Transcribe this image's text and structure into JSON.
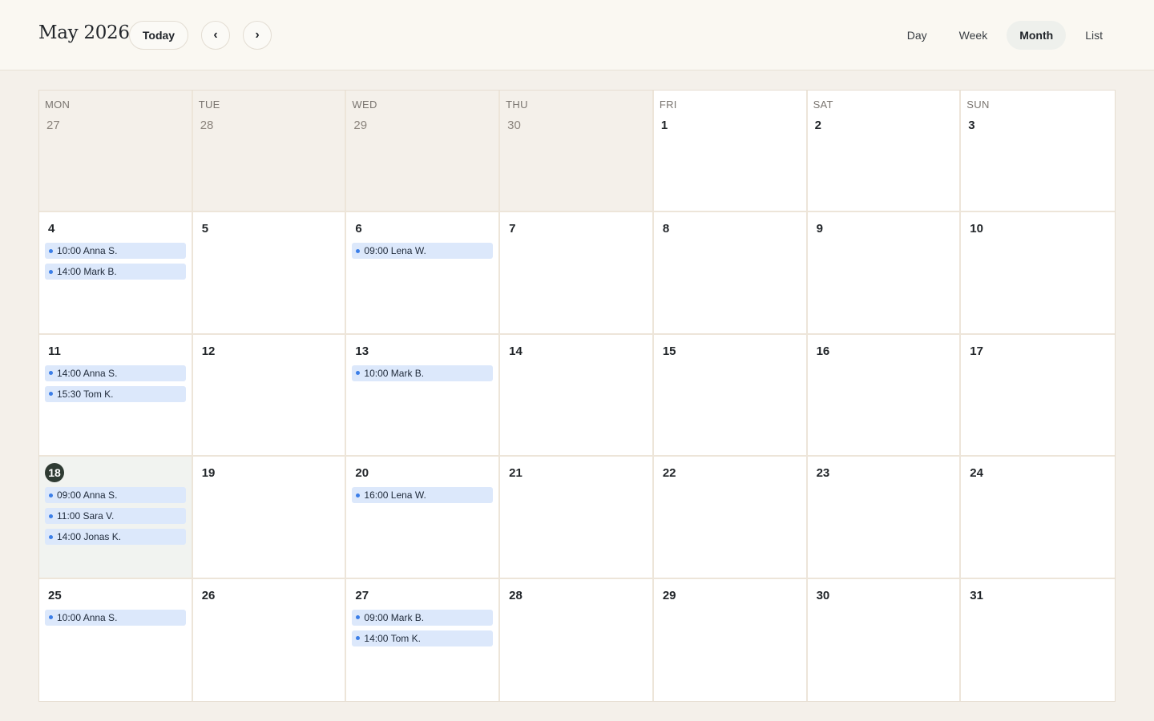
{
  "header": {
    "title": "May 2026",
    "today_label": "Today",
    "prev_label": "‹",
    "next_label": "›",
    "views": [
      {
        "label": "Day",
        "active": false
      },
      {
        "label": "Week",
        "active": false
      },
      {
        "label": "Month",
        "active": true
      },
      {
        "label": "List",
        "active": false
      }
    ]
  },
  "colors": {
    "event_bg": "#dce8fb",
    "event_dot": "#3b7ee8",
    "today_badge": "#2f3b33"
  },
  "weekdays": [
    "MON",
    "TUE",
    "WED",
    "THU",
    "FRI",
    "SAT",
    "SUN"
  ],
  "weeks": [
    [
      {
        "day": "27",
        "outside": true,
        "events": []
      },
      {
        "day": "28",
        "outside": true,
        "events": []
      },
      {
        "day": "29",
        "outside": true,
        "events": []
      },
      {
        "day": "30",
        "outside": true,
        "events": []
      },
      {
        "day": "1",
        "events": []
      },
      {
        "day": "2",
        "events": []
      },
      {
        "day": "3",
        "events": []
      }
    ],
    [
      {
        "day": "4",
        "events": [
          "10:00 Anna S.",
          "14:00 Mark B."
        ]
      },
      {
        "day": "5",
        "events": []
      },
      {
        "day": "6",
        "events": [
          "09:00 Lena W."
        ]
      },
      {
        "day": "7",
        "events": []
      },
      {
        "day": "8",
        "events": []
      },
      {
        "day": "9",
        "events": []
      },
      {
        "day": "10",
        "events": []
      }
    ],
    [
      {
        "day": "11",
        "events": [
          "14:00 Anna S.",
          "15:30 Tom K."
        ]
      },
      {
        "day": "12",
        "events": []
      },
      {
        "day": "13",
        "events": [
          "10:00 Mark B."
        ]
      },
      {
        "day": "14",
        "events": []
      },
      {
        "day": "15",
        "events": []
      },
      {
        "day": "16",
        "events": []
      },
      {
        "day": "17",
        "events": []
      }
    ],
    [
      {
        "day": "18",
        "today": true,
        "events": [
          "09:00 Anna S.",
          "11:00 Sara V.",
          "14:00 Jonas K."
        ]
      },
      {
        "day": "19",
        "events": []
      },
      {
        "day": "20",
        "events": [
          "16:00 Lena W."
        ]
      },
      {
        "day": "21",
        "events": []
      },
      {
        "day": "22",
        "events": []
      },
      {
        "day": "23",
        "events": []
      },
      {
        "day": "24",
        "events": []
      }
    ],
    [
      {
        "day": "25",
        "events": [
          "10:00 Anna S."
        ]
      },
      {
        "day": "26",
        "events": []
      },
      {
        "day": "27",
        "events": [
          "09:00 Mark B.",
          "14:00 Tom K."
        ]
      },
      {
        "day": "28",
        "events": []
      },
      {
        "day": "29",
        "events": []
      },
      {
        "day": "30",
        "events": []
      },
      {
        "day": "31",
        "events": []
      }
    ]
  ]
}
